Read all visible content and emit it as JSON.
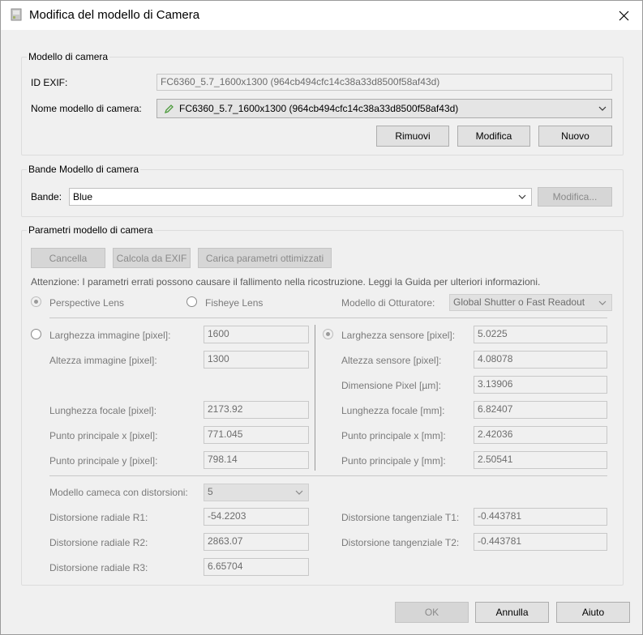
{
  "window": {
    "title": "Modifica del modello di Camera"
  },
  "camera_model": {
    "group_title": "Modello di camera",
    "exif_label": "ID EXIF:",
    "exif_value": "FC6360_5.7_1600x1300 (964cb494cfc14c38a33d8500f58af43d)",
    "name_label": "Nome modello di camera:",
    "name_value": "FC6360_5.7_1600x1300 (964cb494cfc14c38a33d8500f58af43d)",
    "remove_button": "Rimuovi",
    "edit_button": "Modifica",
    "new_button": "Nuovo"
  },
  "bands": {
    "group_title": "Bande Modello di camera",
    "label": "Bande:",
    "value": "Blue",
    "edit_button": "Modifica..."
  },
  "params": {
    "group_title": "Parametri modello di camera",
    "cancel_button": "Cancella",
    "exif_button": "Calcola da EXIF",
    "load_button": "Carica parametri ottimizzati",
    "warning": "Attenzione: I parametri errati possono causare il fallimento nella ricostruzione. Leggi la Guida per ulteriori informazioni.",
    "perspective_label": "Perspective Lens",
    "fisheye_label": "Fisheye Lens",
    "shutter_label": "Modello di Otturatore:",
    "shutter_value": "Global Shutter o Fast Readout",
    "left": {
      "width_label": "Larghezza immagine [pixel]:",
      "width_value": "1600",
      "height_label": "Altezza immagine [pixel]:",
      "height_value": "1300",
      "focal_label": "Lunghezza focale [pixel]:",
      "focal_value": "2173.92",
      "ppx_label": "Punto principale x [pixel]:",
      "ppx_value": "771.045",
      "ppy_label": "Punto principale y [pixel]:",
      "ppy_value": "798.14"
    },
    "right": {
      "width_label": "Larghezza sensore [pixel]:",
      "width_value": "5.0225",
      "height_label": "Altezza sensore [pixel]:",
      "height_value": "4.08078",
      "pixel_label": "Dimensione Pixel [µm]:",
      "pixel_value": "3.13906",
      "focal_label": "Lunghezza focale [mm]:",
      "focal_value": "6.82407",
      "ppx_label": "Punto principale x [mm]:",
      "ppx_value": "2.42036",
      "ppy_label": "Punto principale y [mm]:",
      "ppy_value": "2.50541"
    },
    "distortion_label": "Modello cameca con distorsioni:",
    "distortion_value": "5",
    "r1_label": "Distorsione radiale R1:",
    "r1_value": "-54.2203",
    "r2_label": "Distorsione radiale R2:",
    "r2_value": "2863.07",
    "r3_label": "Distorsione radiale R3:",
    "r3_value": "6.65704",
    "t1_label": "Distorsione tangenziale T1:",
    "t1_value": "-0.443781",
    "t2_label": "Distorsione tangenziale T2:",
    "t2_value": "-0.443781"
  },
  "footer": {
    "ok_button": "OK",
    "cancel_button": "Annulla",
    "help_button": "Aiuto"
  }
}
